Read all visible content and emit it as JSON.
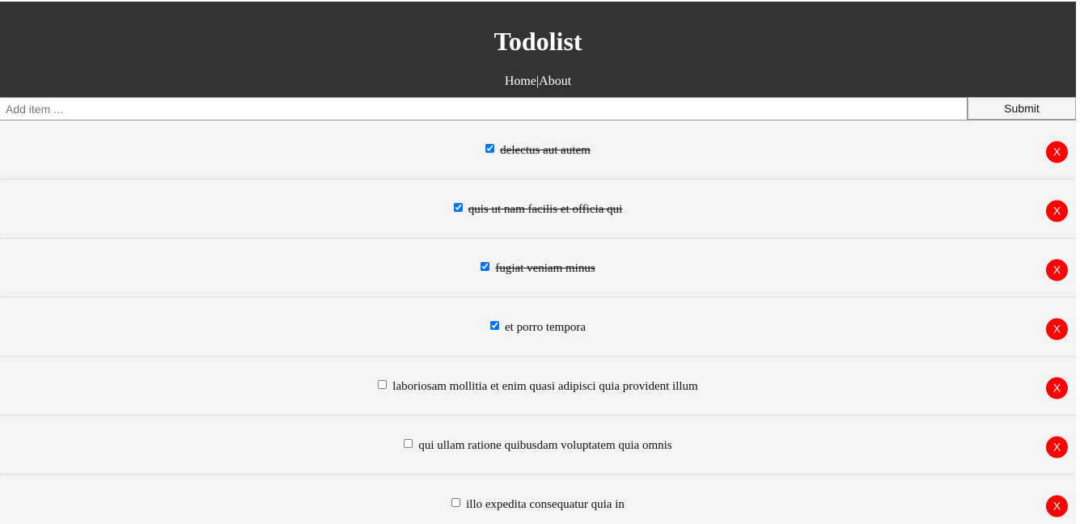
{
  "header": {
    "title": "Todolist",
    "nav": {
      "home": "Home",
      "separator": "|",
      "about": "About"
    }
  },
  "add_form": {
    "placeholder": "Add item ...",
    "value": "",
    "submit_label": "Submit"
  },
  "todos": [
    {
      "text": "delectus aut autem",
      "completed": true,
      "delete_label": "X"
    },
    {
      "text": "quis ut nam facilis et officia qui",
      "completed": true,
      "delete_label": "X"
    },
    {
      "text": "fugiat veniam minus",
      "completed": true,
      "delete_label": "X"
    },
    {
      "text": "et porro tempora",
      "completed": true,
      "delete_label": "X"
    },
    {
      "text": "laboriosam mollitia et enim quasi adipisci quia provident illum",
      "completed": false,
      "delete_label": "X"
    },
    {
      "text": "qui ullam ratione quibusdam voluptatem quia omnis",
      "completed": false,
      "delete_label": "X"
    },
    {
      "text": "illo expedita consequatur quia in",
      "completed": false,
      "delete_label": "X"
    }
  ],
  "colors": {
    "header_bg": "#333333",
    "list_bg": "#f4f4f4",
    "delete_button": "#ff0000"
  }
}
